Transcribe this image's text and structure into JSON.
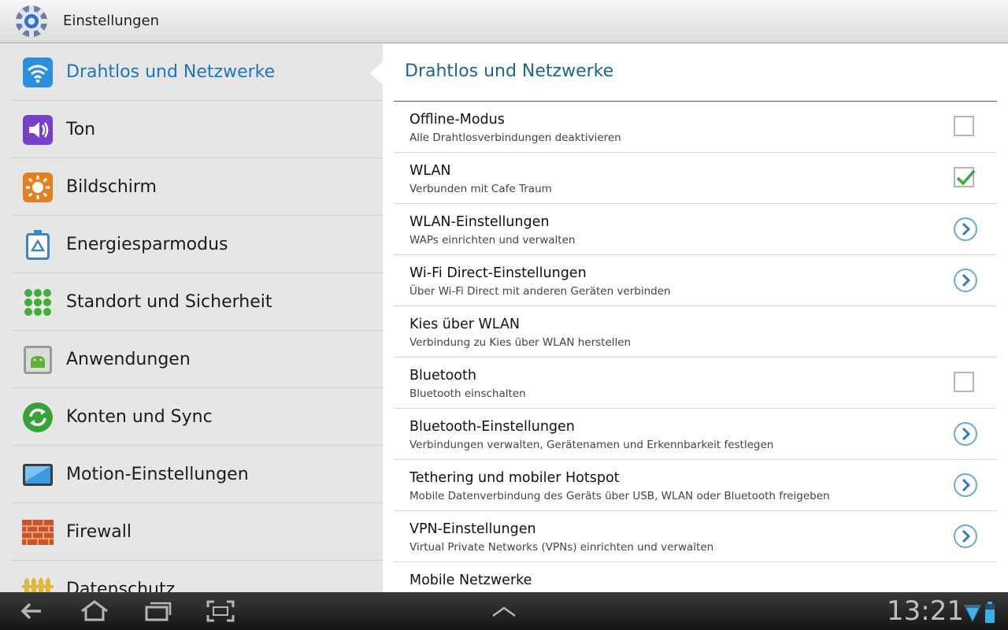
{
  "app": {
    "title": "Einstellungen",
    "icon": "gear-icon"
  },
  "sidebar": {
    "items": [
      {
        "label": "Drahtlos und Netzwerke",
        "icon": "wifi-icon",
        "selected": true
      },
      {
        "label": "Ton",
        "icon": "speaker-icon"
      },
      {
        "label": "Bildschirm",
        "icon": "brightness-icon"
      },
      {
        "label": "Energiesparmodus",
        "icon": "battery-recycle-icon"
      },
      {
        "label": "Standort und Sicherheit",
        "icon": "location-grid-icon"
      },
      {
        "label": "Anwendungen",
        "icon": "android-icon"
      },
      {
        "label": "Konten und Sync",
        "icon": "sync-icon"
      },
      {
        "label": "Motion-Einstellungen",
        "icon": "tablet-icon"
      },
      {
        "label": "Firewall",
        "icon": "firewall-icon"
      },
      {
        "label": "Datenschutz",
        "icon": "fence-icon"
      }
    ]
  },
  "detail": {
    "title": "Drahtlos und Netzwerke",
    "rows": [
      {
        "title": "Offline-Modus",
        "subtitle": "Alle Drahtlosverbindungen deaktivieren",
        "control": "checkbox",
        "checked": false
      },
      {
        "title": "WLAN",
        "subtitle": "Verbunden mit Cafe Traum",
        "control": "checkbox",
        "checked": true
      },
      {
        "title": "WLAN-Einstellungen",
        "subtitle": "WAPs einrichten und verwalten",
        "control": "chevron"
      },
      {
        "title": "Wi-Fi Direct-Einstellungen",
        "subtitle": "Über Wi-Fi Direct mit anderen Geräten verbinden",
        "control": "chevron"
      },
      {
        "title": "Kies über WLAN",
        "subtitle": "Verbindung zu Kies über WLAN herstellen",
        "control": "none"
      },
      {
        "title": "Bluetooth",
        "subtitle": "Bluetooth einschalten",
        "control": "checkbox",
        "checked": false
      },
      {
        "title": "Bluetooth-Einstellungen",
        "subtitle": "Verbindungen verwalten, Gerätenamen und Erkennbarkeit festlegen",
        "control": "chevron"
      },
      {
        "title": "Tethering und mobiler Hotspot",
        "subtitle": "Mobile Datenverbindung des Geräts über USB, WLAN oder Bluetooth freigeben",
        "control": "chevron"
      },
      {
        "title": "VPN-Einstellungen",
        "subtitle": "Virtual Private Networks (VPNs) einrichten und verwalten",
        "control": "chevron"
      },
      {
        "title": "Mobile Netzwerke",
        "subtitle": "",
        "control": "none"
      }
    ]
  },
  "systembar": {
    "clock": "13:21",
    "buttons": [
      "back-icon",
      "home-icon",
      "recent-apps-icon",
      "screenshot-icon",
      "chevron-up-icon"
    ],
    "status_icons": [
      "wifi-signal-icon",
      "battery-icon"
    ]
  },
  "colors": {
    "accent": "#1d76b8",
    "title": "#1b6690",
    "check": "#3aa83a"
  }
}
